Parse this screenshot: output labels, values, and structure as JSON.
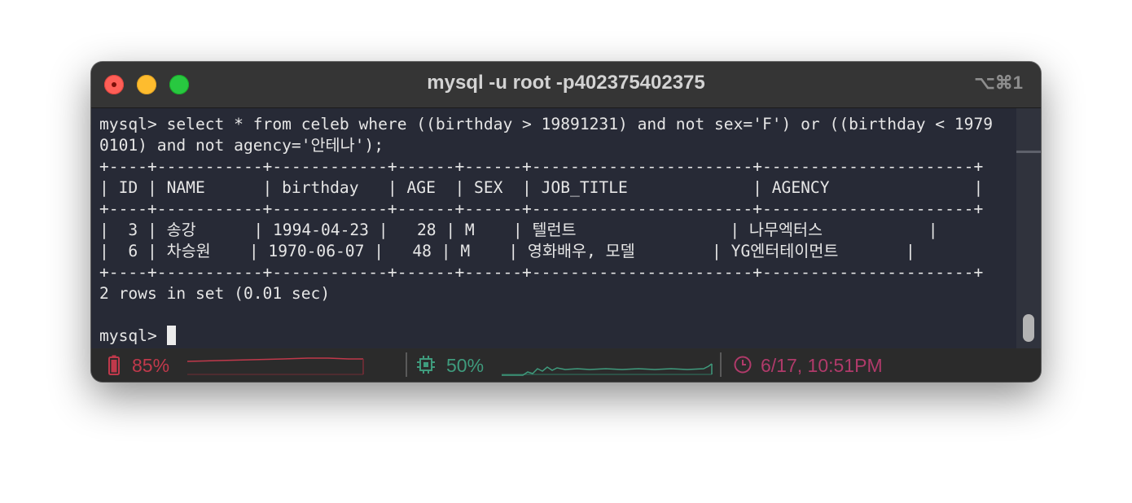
{
  "window": {
    "title": "mysql -u root -p402375402375",
    "shortcut": "⌥⌘1"
  },
  "terminal": {
    "lines": [
      "mysql> select * from celeb where ((birthday > 19891231) and not sex='F') or ((birthday < 1979",
      "0101) and not agency='안테나');",
      "+----+-----------+------------+------+------+-----------------------+----------------------+",
      "| ID | NAME      | birthday   | AGE  | SEX  | JOB_TITLE             | AGENCY               |",
      "+----+-----------+------------+------+------+-----------------------+----------------------+",
      "|  3 | 송강      | 1994-04-23 |   28 | M    | 텔런트                | 나무엑터스           |",
      "|  6 | 차승원    | 1970-06-07 |   48 | M    | 영화배우, 모델        | YG엔터테이먼트       |",
      "+----+-----------+------------+------+------+-----------------------+----------------------+",
      "2 rows in set (0.01 sec)",
      "",
      "mysql> "
    ]
  },
  "statusbar": {
    "battery": {
      "text": "85%",
      "color": "#c0394b",
      "icon": "battery-icon"
    },
    "cpu": {
      "text": "50%",
      "color": "#3f9b7d",
      "icon": "cpu-icon"
    },
    "clock": {
      "text": "6/17, 10:51PM",
      "color": "#b03a6a",
      "icon": "clock-icon"
    }
  }
}
